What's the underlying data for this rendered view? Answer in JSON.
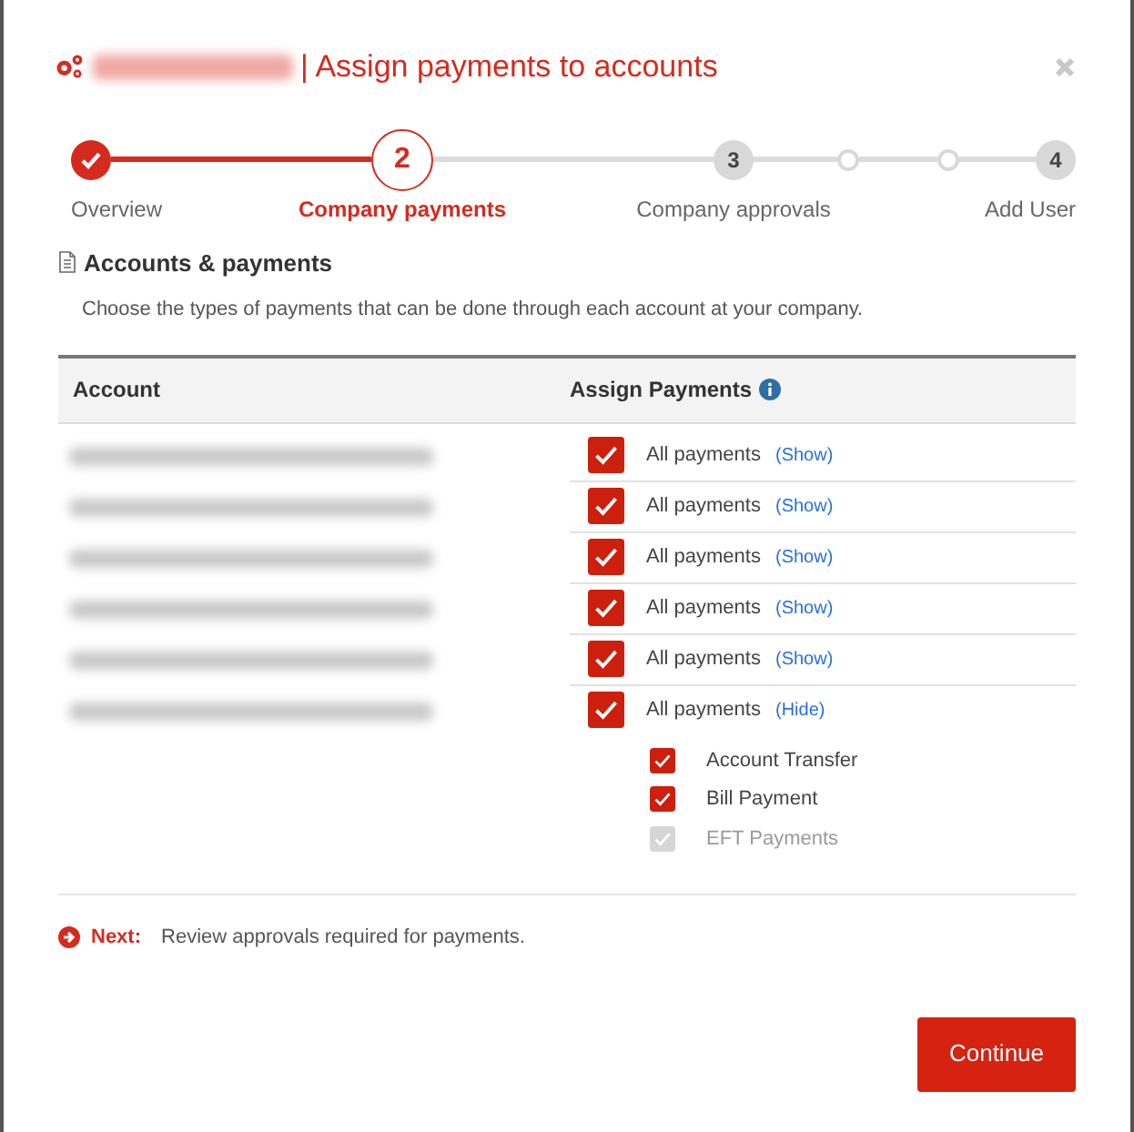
{
  "window": {
    "title": "| Assign payments to accounts",
    "title_redacted": true
  },
  "steps": [
    {
      "kind": "done",
      "label": "Overview"
    },
    {
      "kind": "current",
      "number": "2",
      "label": "Company payments"
    },
    {
      "kind": "pending",
      "number": "3",
      "label": "Company approvals"
    },
    {
      "kind": "dot"
    },
    {
      "kind": "dot"
    },
    {
      "kind": "pending",
      "number": "4",
      "label": "Add User"
    }
  ],
  "section": {
    "title": "Accounts & payments",
    "description": "Choose the types of payments that can be done through each account at your company."
  },
  "table": {
    "columns": [
      "Account",
      "Assign Payments"
    ],
    "rows": [
      {
        "account_redacted": true,
        "label": "All payments",
        "checked": true,
        "toggle": "(Show)"
      },
      {
        "account_redacted": true,
        "label": "All payments",
        "checked": true,
        "toggle": "(Show)"
      },
      {
        "account_redacted": true,
        "label": "All payments",
        "checked": true,
        "toggle": "(Show)"
      },
      {
        "account_redacted": true,
        "label": "All payments",
        "checked": true,
        "toggle": "(Show)"
      },
      {
        "account_redacted": true,
        "label": "All payments",
        "checked": true,
        "toggle": "(Show)"
      },
      {
        "account_redacted": true,
        "label": "All payments",
        "checked": true,
        "toggle": "(Hide)",
        "children": [
          {
            "label": "Account Transfer",
            "checked": true,
            "disabled": false
          },
          {
            "label": "Bill Payment",
            "checked": true,
            "disabled": false
          },
          {
            "label": "EFT Payments",
            "checked": true,
            "disabled": true
          }
        ]
      }
    ]
  },
  "next": {
    "label": "Next:",
    "text": "Review approvals required for payments."
  },
  "buttons": [
    "Continue"
  ]
}
